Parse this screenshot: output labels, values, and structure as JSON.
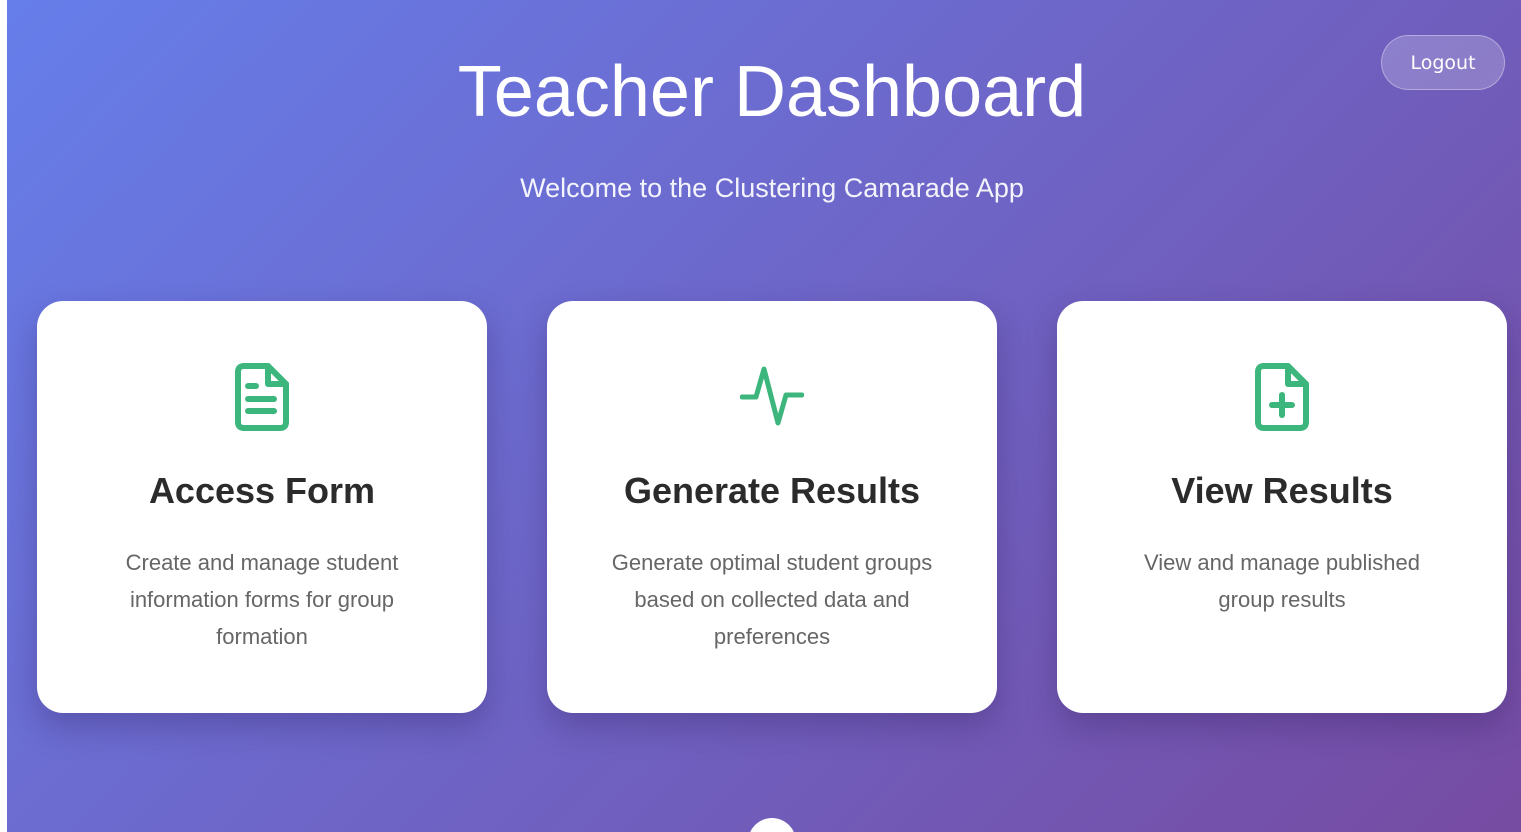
{
  "header": {
    "title": "Teacher Dashboard",
    "subtitle": "Welcome to the Clustering Camarade App",
    "logout_label": "Logout"
  },
  "cards": [
    {
      "icon": "document-text-icon",
      "title": "Access Form",
      "description": "Create and manage student information forms for group formation"
    },
    {
      "icon": "activity-pulse-icon",
      "title": "Generate Results",
      "description": "Generate optimal student groups based on collected data and preferences"
    },
    {
      "icon": "document-plus-icon",
      "title": "View Results",
      "description": "View and manage published group results"
    }
  ],
  "colors": {
    "gradient_start": "#667eea",
    "gradient_end": "#764ba2",
    "icon_green": "#3db67d",
    "card_title": "#2b2b2b",
    "card_text": "#666666"
  }
}
